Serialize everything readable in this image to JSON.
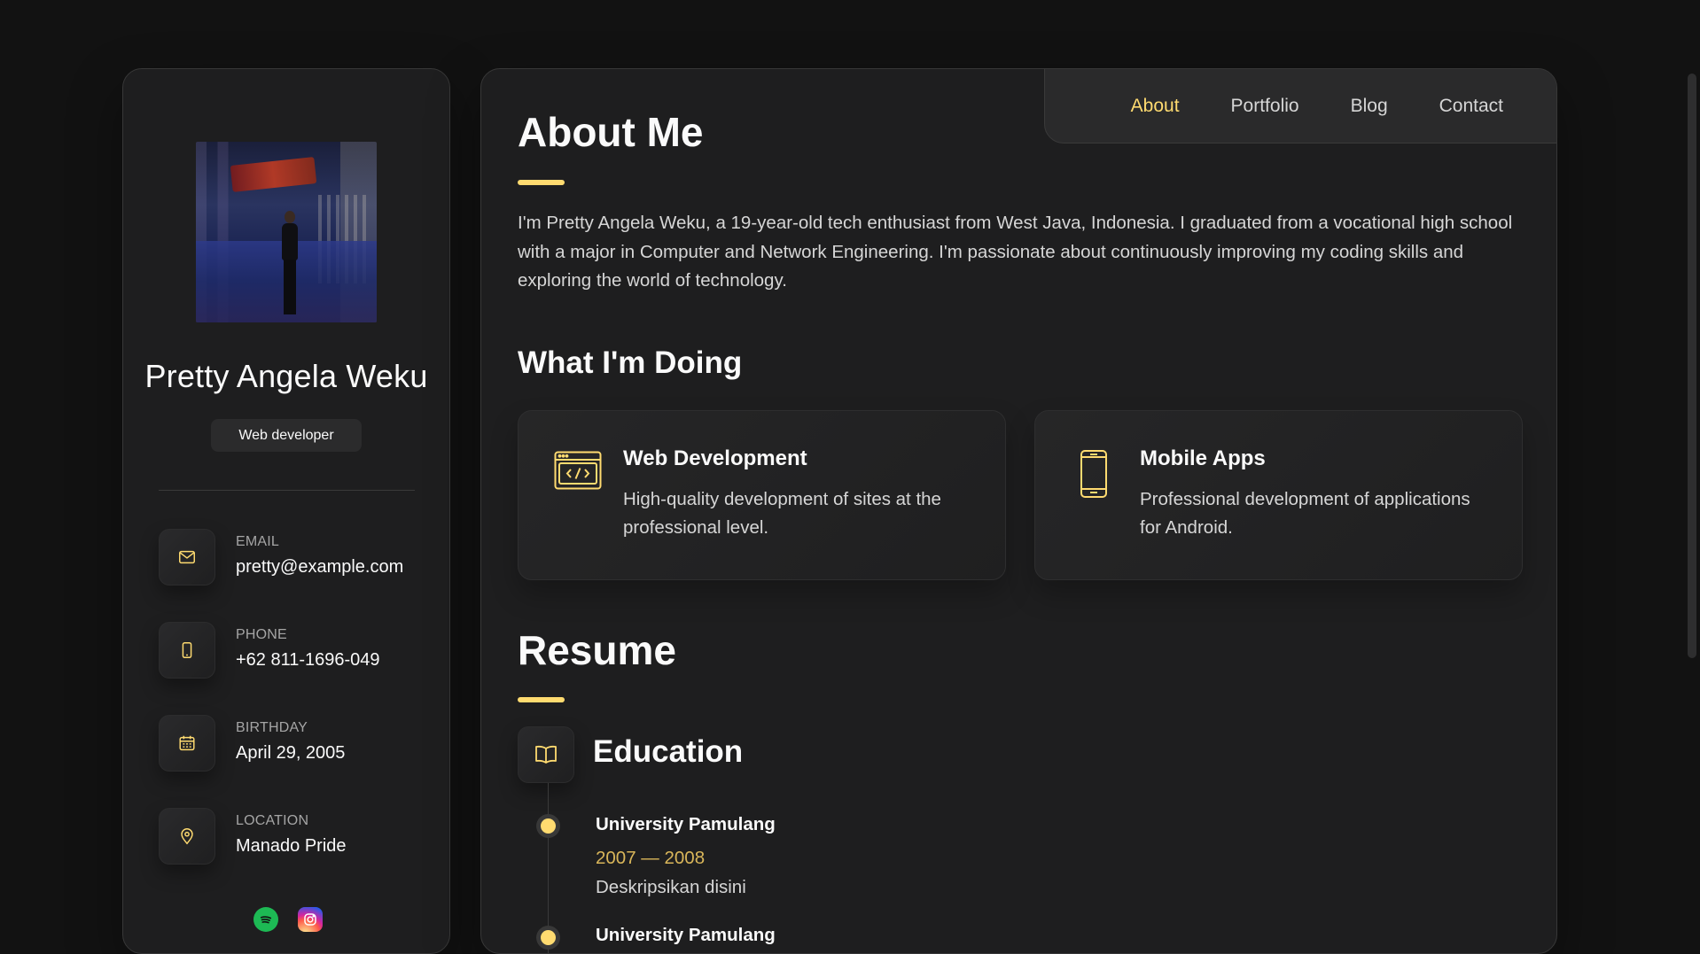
{
  "profile": {
    "name": "Pretty Angela Weku",
    "title": "Web developer",
    "contacts": [
      {
        "label": "Email",
        "value": "pretty@example.com",
        "icon": "mail-icon"
      },
      {
        "label": "Phone",
        "value": "+62 811-1696-049",
        "icon": "phone-icon"
      },
      {
        "label": "Birthday",
        "value": "April 29, 2005",
        "icon": "calendar-icon"
      },
      {
        "label": "Location",
        "value": "Manado Pride",
        "icon": "location-pin-icon"
      }
    ],
    "socials": [
      "spotify-icon",
      "instagram-icon"
    ]
  },
  "nav": {
    "items": [
      {
        "label": "About",
        "active": true
      },
      {
        "label": "Portfolio",
        "active": false
      },
      {
        "label": "Blog",
        "active": false
      },
      {
        "label": "Contact",
        "active": false
      }
    ]
  },
  "about": {
    "title": "About Me",
    "text": "I'm Pretty Angela Weku, a 19-year-old tech enthusiast from West Java, Indonesia. I graduated from a vocational high school with a major in Computer and Network Engineering. I'm passionate about continuously improving my coding skills and exploring the world of technology."
  },
  "services": {
    "title": "What I'm Doing",
    "items": [
      {
        "title": "Web Development",
        "text": "High-quality development of sites at the professional level.",
        "icon": "code-window-icon"
      },
      {
        "title": "Mobile Apps",
        "text": "Professional development of applications for Android.",
        "icon": "smartphone-icon"
      }
    ]
  },
  "resume": {
    "title": "Resume",
    "education": {
      "title": "Education",
      "icon": "book-icon",
      "items": [
        {
          "school": "University Pamulang",
          "years": "2007 — 2008",
          "desc": "Deskripsikan disini"
        },
        {
          "school": "University Pamulang",
          "years": "",
          "desc": ""
        }
      ]
    }
  },
  "colors": {
    "accent": "#ffdb70",
    "background": "#121212",
    "card": "#1e1e1f"
  }
}
